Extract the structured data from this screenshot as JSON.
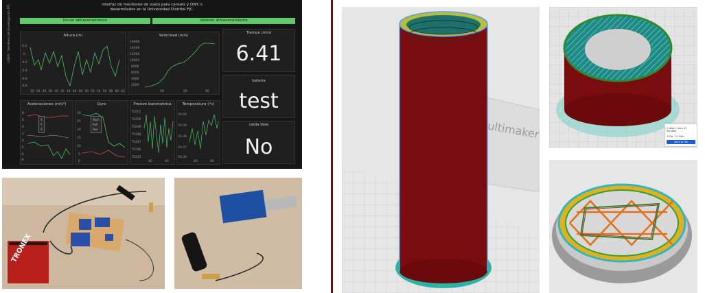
{
  "dashboard": {
    "title_line1": "interfaz de monitoreo de vuelo para cansats y OWC's",
    "title_line2": "desarrollados en la Universidad Distrital FJC.",
    "start_button": "iniciar almacenamiento",
    "stop_button": "detener almacenamiento",
    "side_label": "LIDER - Semillero de investigación RTL",
    "altura_title": "Altura (m)",
    "altura_xticks": [
      "32",
      "34",
      "36",
      "38",
      "40",
      "42",
      "44",
      "46",
      "48",
      "50",
      "52",
      "54",
      "56",
      "58",
      "60",
      "62"
    ],
    "altura_yticks": [
      "0.2",
      "0",
      "-0.2",
      "-0.4",
      "-0.6",
      "-0.8"
    ],
    "velocidad_title": "Velocidad (m/s)",
    "velocidad_xticks": [
      "40",
      "50",
      "60"
    ],
    "velocidad_yticks": [
      "16000",
      "14000",
      "12000",
      "10000",
      "8000",
      "6000",
      "4000",
      "2000"
    ],
    "tiempo_title": "Tiempo (min)",
    "tiempo_value": "6.41",
    "bateria_title": "bateria",
    "bateria_value": "test",
    "caida_title": "caida libre",
    "caida_value": "No",
    "acel_title": "Aceleraciones (m/s²)",
    "acel_legend": [
      "X",
      "Y",
      "Z"
    ],
    "acel_yticks": [
      "8",
      "6",
      "4",
      "2",
      "0",
      "-2",
      "-4",
      "-6"
    ],
    "gyro_title": "Gyro",
    "gyro_legend": [
      "Pitch",
      "Roll",
      "Yaw"
    ],
    "gyro_yticks": [
      "30",
      "25",
      "20",
      "15",
      "10",
      "5",
      "0"
    ],
    "presion_title": "Presion barometrica",
    "presion_yticks": [
      "75251",
      "75250",
      "75249",
      "75248",
      "75247",
      "75246",
      "75245"
    ],
    "presion_xticks": [
      "40",
      "60"
    ],
    "temp_title": "Temperatura (°c)",
    "temp_yticks": [
      "30.40",
      "30.39",
      "30.38",
      "30.37",
      "30.36"
    ],
    "temp_xticks": [
      "40",
      "60"
    ]
  },
  "photos": {
    "battery_label": "TRONEX"
  },
  "cura": {
    "brand_text": "ultimaker",
    "popup_time": "2 days 1 hour 12 minutes",
    "popup_material": "130g · 22.34m",
    "popup_save": "Save to File"
  },
  "colors": {
    "dashboard_bg": "#161616",
    "button_green": "#63c96a",
    "wall_red": "#7a0c10",
    "infill_teal": "#1a7a7a",
    "cura_bg": "#e6e6e6"
  }
}
